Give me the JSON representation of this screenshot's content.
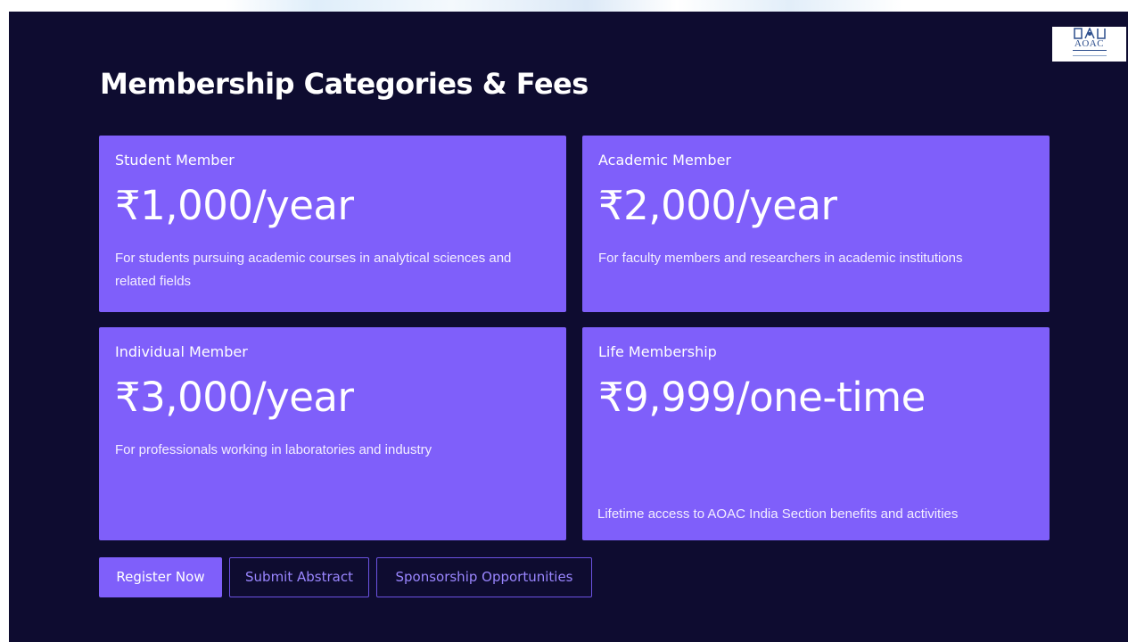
{
  "page": {
    "title": "Membership Categories & Fees",
    "background_color": "#0e0c30",
    "card_color": "#7f5ffa"
  },
  "logo": {
    "text": "AOAC",
    "icon": "aoac-logo"
  },
  "cards": [
    {
      "name": "Student Member",
      "price": "₹1,000/year",
      "description": "For students pursuing academic courses in analytical sciences and related fields"
    },
    {
      "name": "Academic Member",
      "price": "₹2,000/year",
      "description": "For faculty members and researchers in academic institutions"
    },
    {
      "name": "Individual Member",
      "price": "₹3,000/year",
      "description": "For professionals working in laboratories and industry"
    },
    {
      "name": "Life Membership",
      "price": "₹9,999/one-time",
      "description": "Lifetime access to AOAC India Section benefits and activities"
    }
  ],
  "buttons": {
    "register": "Register Now",
    "submit_abstract": "Submit Abstract",
    "sponsorship": "Sponsorship Opportunities"
  }
}
